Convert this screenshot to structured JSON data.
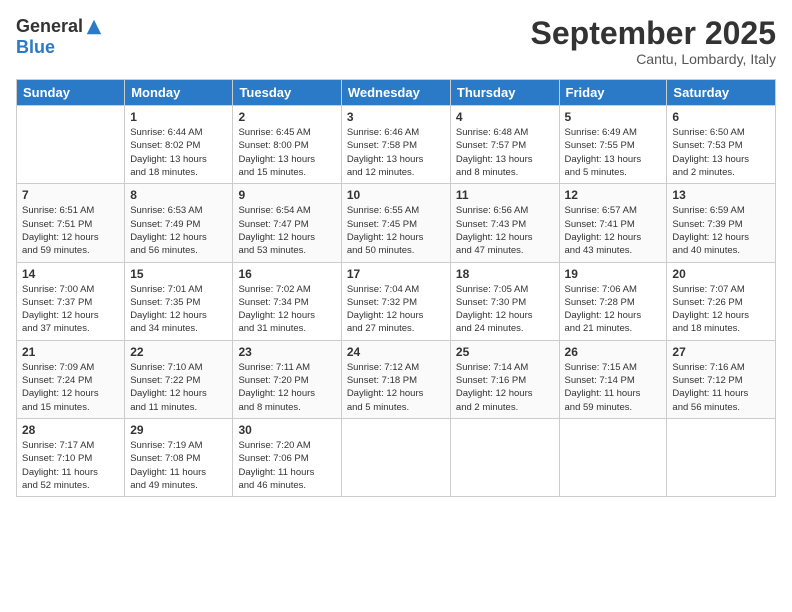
{
  "header": {
    "logo": {
      "general": "General",
      "blue": "Blue"
    },
    "title": "September 2025",
    "subtitle": "Cantu, Lombardy, Italy"
  },
  "days_of_week": [
    "Sunday",
    "Monday",
    "Tuesday",
    "Wednesday",
    "Thursday",
    "Friday",
    "Saturday"
  ],
  "weeks": [
    [
      {
        "day": "",
        "info": ""
      },
      {
        "day": "1",
        "info": "Sunrise: 6:44 AM\nSunset: 8:02 PM\nDaylight: 13 hours\nand 18 minutes."
      },
      {
        "day": "2",
        "info": "Sunrise: 6:45 AM\nSunset: 8:00 PM\nDaylight: 13 hours\nand 15 minutes."
      },
      {
        "day": "3",
        "info": "Sunrise: 6:46 AM\nSunset: 7:58 PM\nDaylight: 13 hours\nand 12 minutes."
      },
      {
        "day": "4",
        "info": "Sunrise: 6:48 AM\nSunset: 7:57 PM\nDaylight: 13 hours\nand 8 minutes."
      },
      {
        "day": "5",
        "info": "Sunrise: 6:49 AM\nSunset: 7:55 PM\nDaylight: 13 hours\nand 5 minutes."
      },
      {
        "day": "6",
        "info": "Sunrise: 6:50 AM\nSunset: 7:53 PM\nDaylight: 13 hours\nand 2 minutes."
      }
    ],
    [
      {
        "day": "7",
        "info": "Sunrise: 6:51 AM\nSunset: 7:51 PM\nDaylight: 12 hours\nand 59 minutes."
      },
      {
        "day": "8",
        "info": "Sunrise: 6:53 AM\nSunset: 7:49 PM\nDaylight: 12 hours\nand 56 minutes."
      },
      {
        "day": "9",
        "info": "Sunrise: 6:54 AM\nSunset: 7:47 PM\nDaylight: 12 hours\nand 53 minutes."
      },
      {
        "day": "10",
        "info": "Sunrise: 6:55 AM\nSunset: 7:45 PM\nDaylight: 12 hours\nand 50 minutes."
      },
      {
        "day": "11",
        "info": "Sunrise: 6:56 AM\nSunset: 7:43 PM\nDaylight: 12 hours\nand 47 minutes."
      },
      {
        "day": "12",
        "info": "Sunrise: 6:57 AM\nSunset: 7:41 PM\nDaylight: 12 hours\nand 43 minutes."
      },
      {
        "day": "13",
        "info": "Sunrise: 6:59 AM\nSunset: 7:39 PM\nDaylight: 12 hours\nand 40 minutes."
      }
    ],
    [
      {
        "day": "14",
        "info": "Sunrise: 7:00 AM\nSunset: 7:37 PM\nDaylight: 12 hours\nand 37 minutes."
      },
      {
        "day": "15",
        "info": "Sunrise: 7:01 AM\nSunset: 7:35 PM\nDaylight: 12 hours\nand 34 minutes."
      },
      {
        "day": "16",
        "info": "Sunrise: 7:02 AM\nSunset: 7:34 PM\nDaylight: 12 hours\nand 31 minutes."
      },
      {
        "day": "17",
        "info": "Sunrise: 7:04 AM\nSunset: 7:32 PM\nDaylight: 12 hours\nand 27 minutes."
      },
      {
        "day": "18",
        "info": "Sunrise: 7:05 AM\nSunset: 7:30 PM\nDaylight: 12 hours\nand 24 minutes."
      },
      {
        "day": "19",
        "info": "Sunrise: 7:06 AM\nSunset: 7:28 PM\nDaylight: 12 hours\nand 21 minutes."
      },
      {
        "day": "20",
        "info": "Sunrise: 7:07 AM\nSunset: 7:26 PM\nDaylight: 12 hours\nand 18 minutes."
      }
    ],
    [
      {
        "day": "21",
        "info": "Sunrise: 7:09 AM\nSunset: 7:24 PM\nDaylight: 12 hours\nand 15 minutes."
      },
      {
        "day": "22",
        "info": "Sunrise: 7:10 AM\nSunset: 7:22 PM\nDaylight: 12 hours\nand 11 minutes."
      },
      {
        "day": "23",
        "info": "Sunrise: 7:11 AM\nSunset: 7:20 PM\nDaylight: 12 hours\nand 8 minutes."
      },
      {
        "day": "24",
        "info": "Sunrise: 7:12 AM\nSunset: 7:18 PM\nDaylight: 12 hours\nand 5 minutes."
      },
      {
        "day": "25",
        "info": "Sunrise: 7:14 AM\nSunset: 7:16 PM\nDaylight: 12 hours\nand 2 minutes."
      },
      {
        "day": "26",
        "info": "Sunrise: 7:15 AM\nSunset: 7:14 PM\nDaylight: 11 hours\nand 59 minutes."
      },
      {
        "day": "27",
        "info": "Sunrise: 7:16 AM\nSunset: 7:12 PM\nDaylight: 11 hours\nand 56 minutes."
      }
    ],
    [
      {
        "day": "28",
        "info": "Sunrise: 7:17 AM\nSunset: 7:10 PM\nDaylight: 11 hours\nand 52 minutes."
      },
      {
        "day": "29",
        "info": "Sunrise: 7:19 AM\nSunset: 7:08 PM\nDaylight: 11 hours\nand 49 minutes."
      },
      {
        "day": "30",
        "info": "Sunrise: 7:20 AM\nSunset: 7:06 PM\nDaylight: 11 hours\nand 46 minutes."
      },
      {
        "day": "",
        "info": ""
      },
      {
        "day": "",
        "info": ""
      },
      {
        "day": "",
        "info": ""
      },
      {
        "day": "",
        "info": ""
      }
    ]
  ]
}
